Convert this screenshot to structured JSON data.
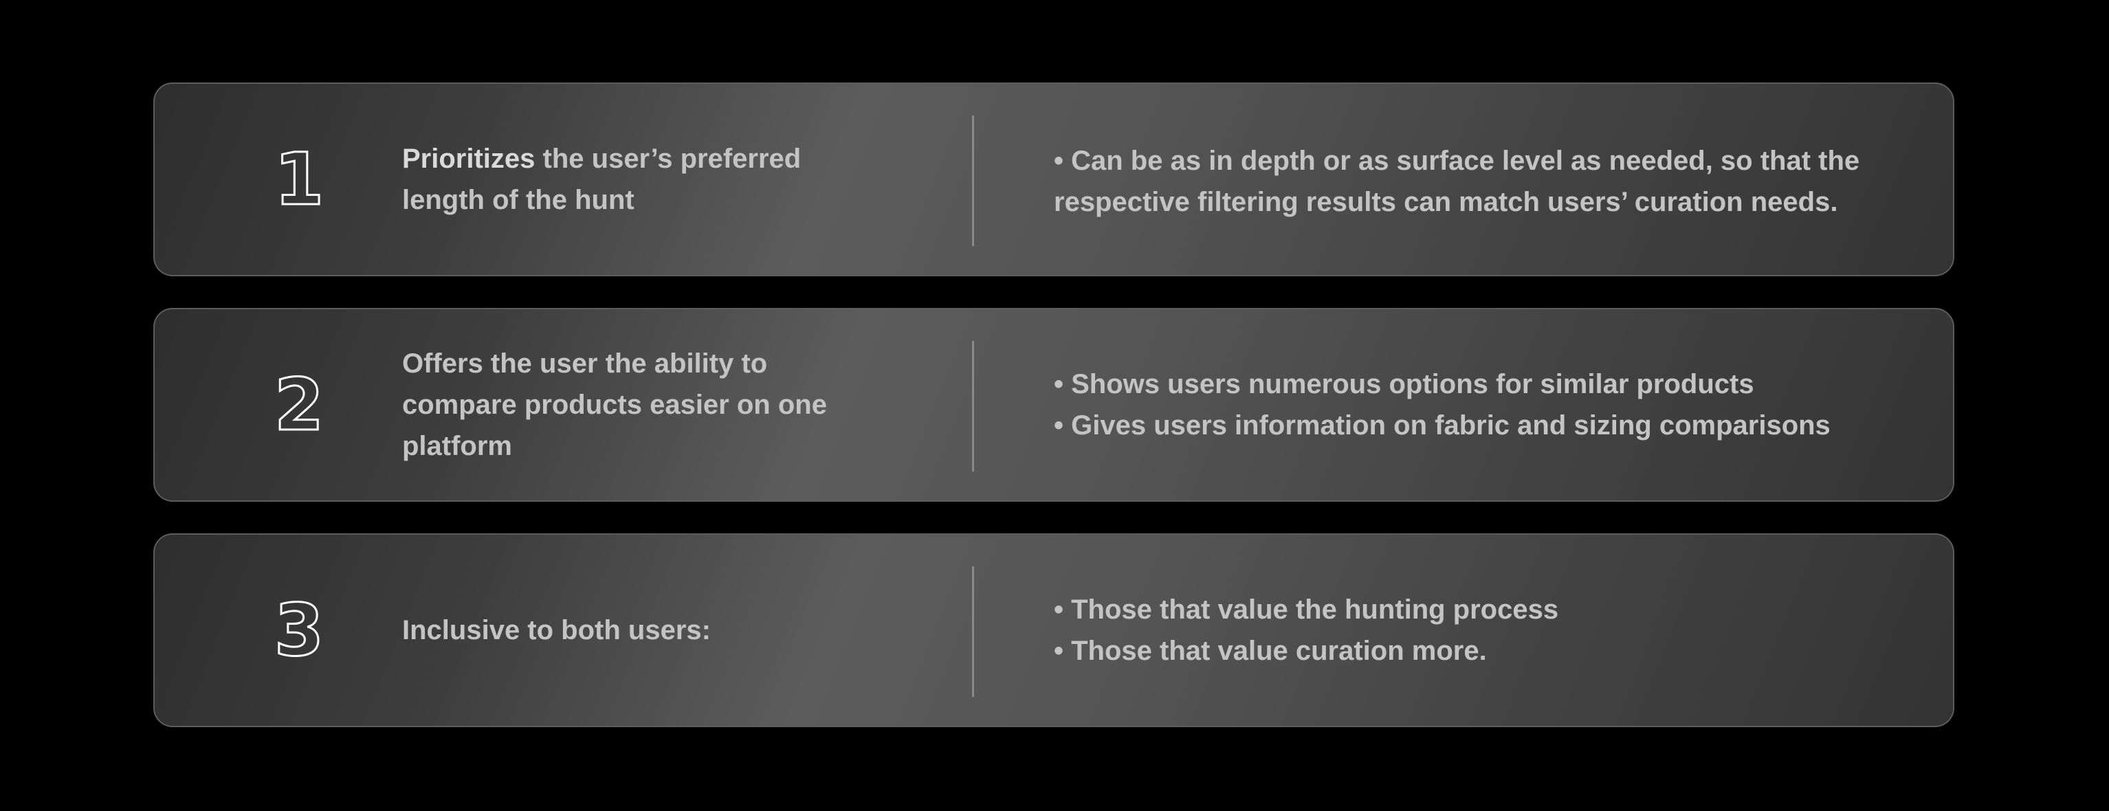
{
  "cards": [
    {
      "number": "1",
      "left_bold": "Prioritizes",
      "left_rest": " the user’s preferred length of the hunt",
      "bullets": [
        "• Can be as in depth or as surface level as needed, so that the respective filtering results can match users’ curation needs."
      ]
    },
    {
      "number": "2",
      "left_bold": "",
      "left_rest": "Offers the user the ability to compare products easier on one platform",
      "bullets": [
        "• Shows users numerous options for similar products",
        "• Gives users information on fabric and sizing comparisons"
      ]
    },
    {
      "number": "3",
      "left_bold": "",
      "left_rest": "Inclusive to both users:",
      "bullets": [
        "• Those that value the hunting process",
        "• Those that value curation more."
      ]
    }
  ]
}
